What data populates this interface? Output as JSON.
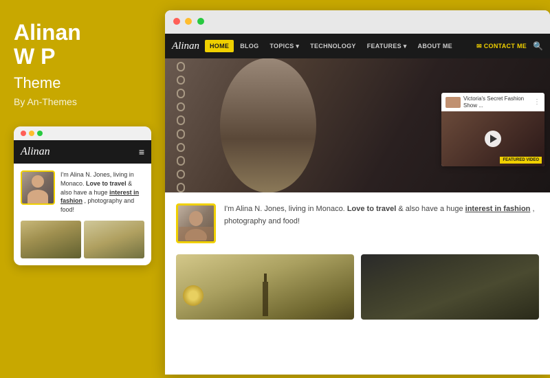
{
  "theme": {
    "title_line1": "Alinan",
    "title_line2": "W P",
    "subtitle": "Theme",
    "by": "By An-Themes"
  },
  "mobile": {
    "logo": "Alinan",
    "bio_text": "I'm Alina N. Jones, living in Monaco.",
    "bio_bold": "Love to travel",
    "bio_cont": "& also have a huge",
    "bio_underline": "interest in fashion",
    "bio_end": ", photography and food!"
  },
  "browser": {
    "nav": {
      "logo": "Alinan",
      "items": [
        "HOME",
        "BLOG",
        "TOPICS",
        "TECHNOLOGY",
        "FEATURES",
        "ABOUT ME"
      ],
      "contact": "✉ CONTACT ME"
    },
    "video": {
      "title": "Victoria's Secret Fashion Show ...",
      "badge": "FEATURED VIDEO"
    },
    "bio": {
      "text_start": "I'm Alina N. Jones, living in Monaco.",
      "bold_part": "Love to travel",
      "text_mid": "& also have a huge",
      "underline_part": "interest in fashion",
      "text_end": ", photography and food!"
    }
  },
  "jones_ref": "Jones"
}
